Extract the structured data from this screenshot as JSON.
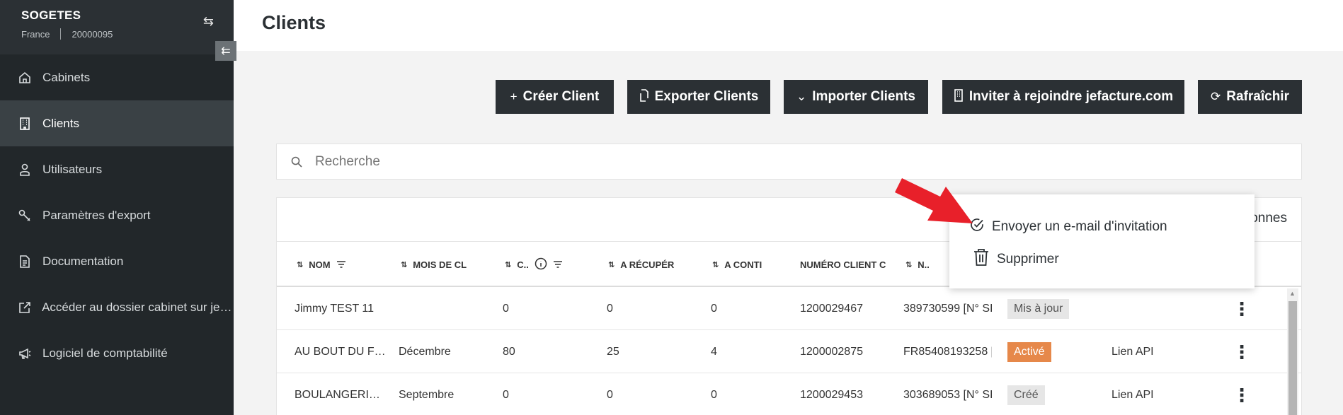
{
  "org": {
    "name": "SOGETES",
    "country": "France",
    "code": "20000095"
  },
  "sidebar": {
    "items": [
      {
        "label": "Cabinets",
        "icon": "home-icon",
        "active": false
      },
      {
        "label": "Clients",
        "icon": "building-icon",
        "active": true
      },
      {
        "label": "Utilisateurs",
        "icon": "user-icon",
        "active": false
      },
      {
        "label": "Paramètres d'export",
        "icon": "wrench-icon",
        "active": false
      },
      {
        "label": "Documentation",
        "icon": "document-icon",
        "active": false
      },
      {
        "label": "Accéder au dossier cabinet sur jefa…",
        "icon": "external-link-icon",
        "active": false
      },
      {
        "label": "Logiciel de comptabilité",
        "icon": "megaphone-icon",
        "active": false
      }
    ]
  },
  "page": {
    "title": "Clients"
  },
  "toolbar": {
    "create": "Créer Client",
    "export": "Exporter Clients",
    "import": "Importer Clients",
    "invite": "Inviter à rejoindre jefacture.com",
    "refresh": "Rafraîchir"
  },
  "search": {
    "placeholder": "Recherche"
  },
  "table": {
    "columns_link": "onnes",
    "headers": [
      "NOM",
      "MOIS DE CL",
      "C..",
      "A RÉCUPÉR",
      "A CONTI",
      "NUMÉRO CLIENT C",
      "N.."
    ],
    "rows": [
      {
        "nom": "Jimmy TEST 11",
        "mois": "",
        "c": "0",
        "recup": "0",
        "conti": "0",
        "numero": "1200029467",
        "n": "389730599 [N° SI",
        "status": "Mis à jour",
        "status_color": "grey",
        "lien": ""
      },
      {
        "nom": "AU BOUT DU F…",
        "mois": "Décembre",
        "c": "80",
        "recup": "25",
        "conti": "4",
        "numero": "1200002875",
        "n": "FR85408193258 [",
        "status": "Activé",
        "status_color": "orange",
        "lien": "Lien API"
      },
      {
        "nom": "BOULANGERI…",
        "mois": "Septembre",
        "c": "0",
        "recup": "0",
        "conti": "0",
        "numero": "1200029453",
        "n": "303689053 [N° SI",
        "status": "Créé",
        "status_color": "grey",
        "lien": "Lien API"
      }
    ]
  },
  "menu": {
    "send_invite": "Envoyer un e-mail d'invitation",
    "delete": "Supprimer"
  },
  "colors": {
    "sidebar": "#22272a",
    "button": "#2b3034",
    "accent_orange": "#e6884a",
    "arrow_red": "#e8202a"
  }
}
